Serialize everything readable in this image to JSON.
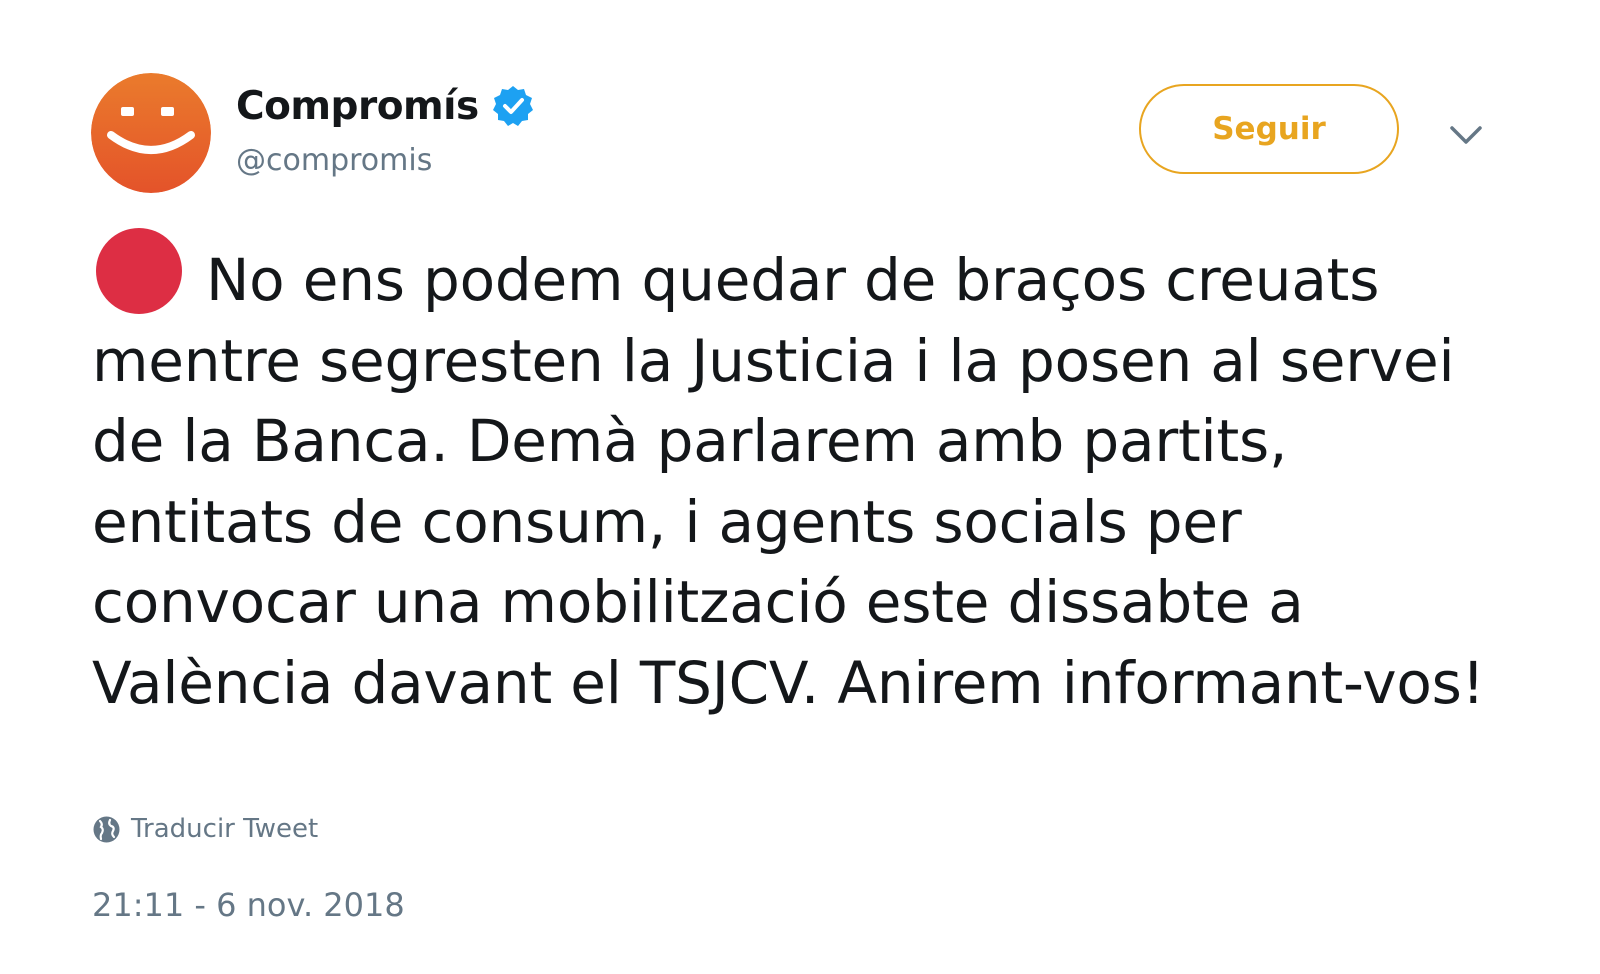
{
  "author": {
    "display_name": "Compromís",
    "handle": "@compromis",
    "verified": true,
    "avatar_icon": "orange-smiley-avatar",
    "avatar_color": "#e8622a"
  },
  "actions": {
    "follow_label": "Seguir",
    "more_icon": "chevron-down-icon"
  },
  "tweet": {
    "emoji_icon": "red-circle-emoji",
    "text": "No ens podem quedar de braços creuats mentre segresten la Justicia i la posen al servei de la Banca. Demà parlarem amb partits, entitats de consum, i agents socials per convocar una mobilització este dissabte a València davant el TSJCV. Anirem informant-vos!",
    "translate_label": "Traducir Tweet",
    "translate_icon": "globe-icon",
    "timestamp": "21:11 - 6 nov. 2018"
  },
  "colors": {
    "follow_accent": "#e8a520",
    "verified": "#1da1f2",
    "muted_text": "#657786",
    "emoji_red": "#dd2e44"
  }
}
